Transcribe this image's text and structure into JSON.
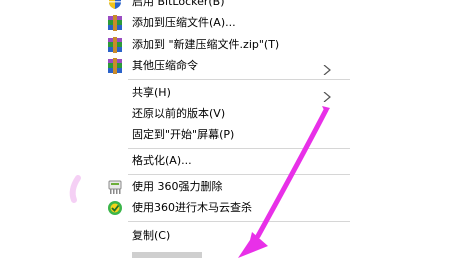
{
  "menu": {
    "bitlocker": {
      "label": "启用 BitLocker(B)",
      "icon": "shield-icon"
    },
    "add_archive": {
      "label": "添加到压缩文件(A)...",
      "icon": "winrar-archive-icon"
    },
    "add_zip": {
      "label": "添加到 \"新建压缩文件.zip\"(T)",
      "icon": "winrar-archive-icon"
    },
    "other_compress": {
      "label": "其他压缩命令",
      "icon": "winrar-archive-icon"
    },
    "share": {
      "label": "共享(H)"
    },
    "restore": {
      "label": "还原以前的版本(V)"
    },
    "pin_start": {
      "label": "固定到\"开始\"屏幕(P)"
    },
    "format": {
      "label": "格式化(A)..."
    },
    "shred360": {
      "label": "使用 360强力删除",
      "icon": "shredder-360-icon"
    },
    "scan360": {
      "label": "使用360进行木马云查杀",
      "icon": "360-security-icon"
    },
    "copy": {
      "label": "复制(C)"
    }
  },
  "colors": {
    "arrow": "#e830e8",
    "separator": "#d6d6d6"
  }
}
